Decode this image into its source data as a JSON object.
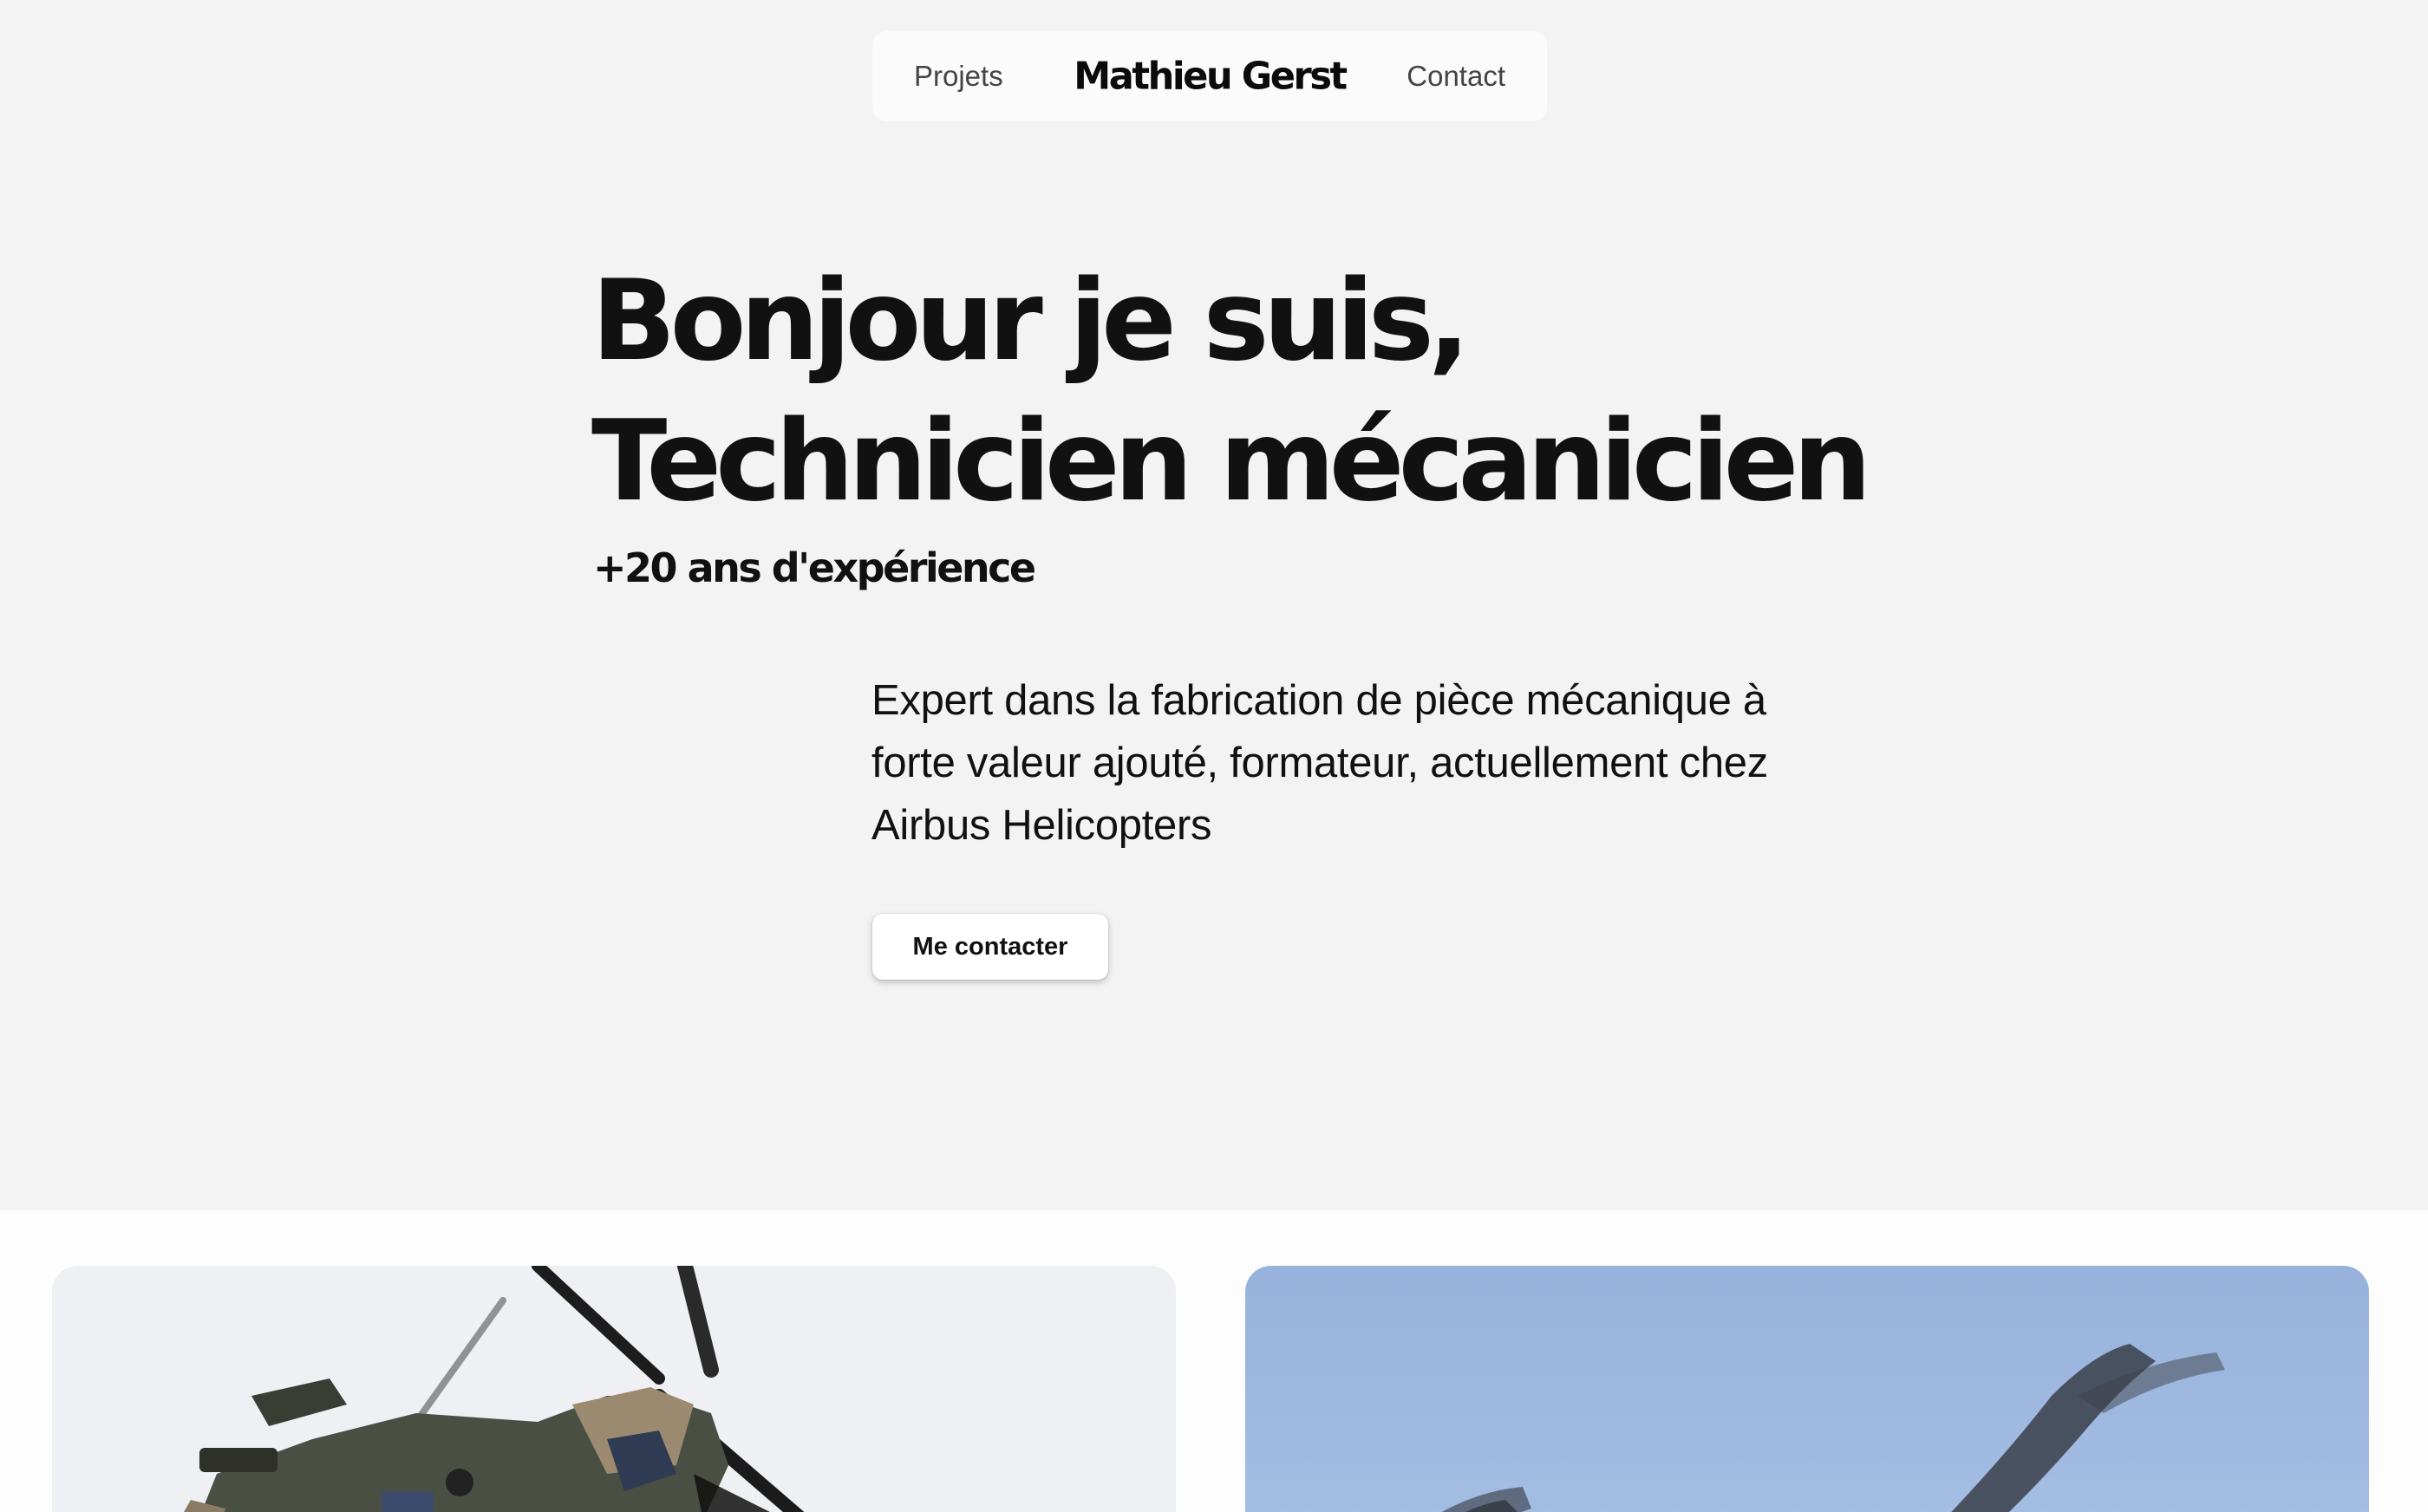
{
  "nav": {
    "projets_label": "Projets",
    "brand": "Mathieu Gerst",
    "contact_label": "Contact"
  },
  "hero": {
    "title_line1": "Bonjour je suis,",
    "title_line2": "Technicien mécanicien",
    "subtitle": "+20 ans d'expérience",
    "description": "Expert dans la fabrication de pièce mécanique à forte valeur ajouté, formateur, actuellement chez Airbus Helicopters",
    "cta_label": "Me contacter"
  },
  "projects": {
    "cards": [
      {
        "image": "military-helicopter-photo"
      },
      {
        "image": "helicopter-rotor-sky-photo"
      }
    ]
  },
  "colors": {
    "hero_bg": "#f3f3f3",
    "nav_bg": "#fbfbfb",
    "text": "#111111",
    "sky": "#9db7df"
  }
}
